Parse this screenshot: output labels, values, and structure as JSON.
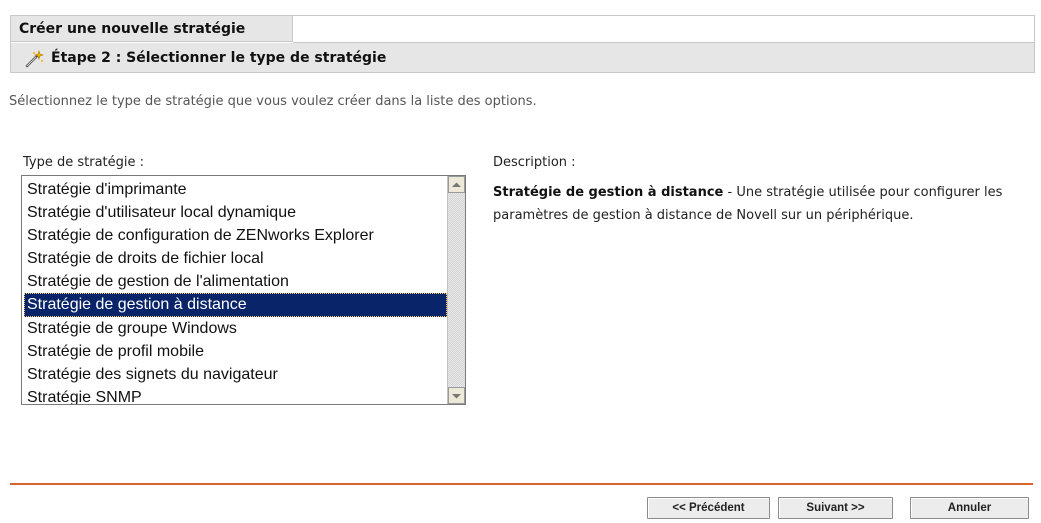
{
  "window": {
    "title": "Créer une nouvelle stratégie",
    "step_icon": "wizard-wand-icon",
    "step_title": "Étape 2 : Sélectionner le type de stratégie"
  },
  "intro_text": "Sélectionnez le type de stratégie que vous voulez créer dans la liste des options.",
  "policy_type": {
    "label": "Type de stratégie :",
    "items": [
      "Stratégie d'imprimante",
      "Stratégie d'utilisateur local dynamique",
      "Stratégie de configuration de ZENworks Explorer",
      "Stratégie de droits de fichier local",
      "Stratégie de gestion de l'alimentation",
      "Stratégie de gestion à distance",
      "Stratégie de groupe Windows",
      "Stratégie de profil mobile",
      "Stratégie des signets du navigateur",
      "Stratégie SNMP"
    ],
    "selected": "Stratégie de gestion à distance"
  },
  "description": {
    "label": "Description :",
    "name": "Stratégie de gestion à distance",
    "text": " - Une stratégie utilisée pour configurer les paramètres de gestion à distance de Novell sur un périphérique."
  },
  "buttons": {
    "previous": "<< Précédent",
    "next": "Suivant >>",
    "cancel": "Annuler"
  },
  "colors": {
    "selection": "#0a246a",
    "divider": "#d7642a",
    "header_bg": "#e6e6e6"
  }
}
